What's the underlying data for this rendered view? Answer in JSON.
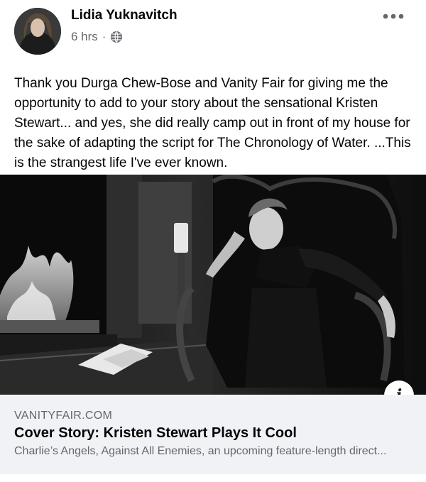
{
  "post": {
    "author": "Lidia Yuknavitch",
    "time": "6 hrs",
    "separator": "·",
    "privacy_icon": "globe-icon",
    "more_icon": "more-horizontal-icon",
    "text": "Thank you Durga Chew-Bose and Vanity Fair for giving me the opportunity to add to your story about the sensational Kristen Stewart... and yes, she did really camp out in front of my house for the sake of adapting the script for The Chronology of Water. ...This is the strangest life I've ever known."
  },
  "link_preview": {
    "info_label": "i",
    "domain": "VANITYFAIR.COM",
    "title": "Cover Story: Kristen Stewart Plays It Cool",
    "description": "Charlie’s Angels, Against All Enemies, an upcoming feature-length direct..."
  },
  "colors": {
    "text_primary": "#050505",
    "text_secondary": "#65676b",
    "footer_bg": "#f0f2f5"
  }
}
